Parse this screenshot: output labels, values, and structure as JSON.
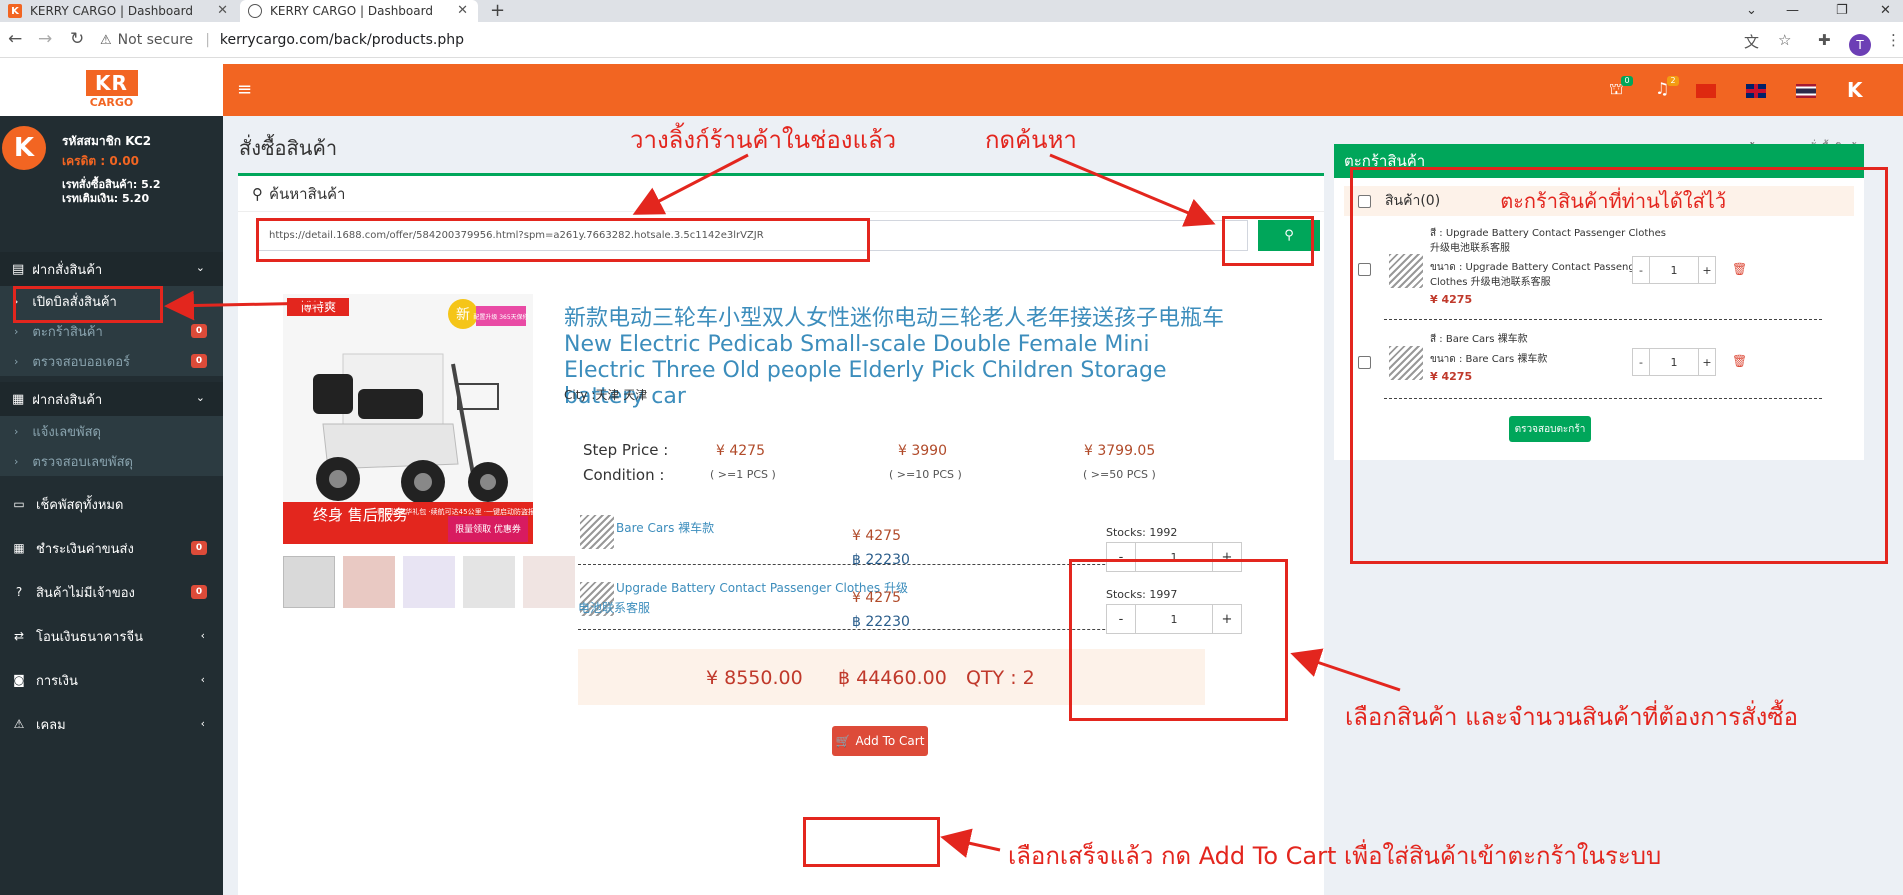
{
  "browser": {
    "tabs": [
      {
        "title": "KERRY CARGO | Dashboard",
        "active": false
      },
      {
        "title": "KERRY CARGO | Dashboard",
        "active": true
      }
    ],
    "new_tab_icon": "plus-icon",
    "not_secure_label": "Not secure",
    "url": "kerrycargo.com/back/products.php",
    "profile_initial": "T"
  },
  "sidebar": {
    "user": {
      "member_code": "รหัสสมาชิก KC2",
      "credit": "เครดิต : 0.00",
      "rate_order": "เรทสั่งซื้อสินค้า: 5.2",
      "rate_topup": "เรทเติมเงิน: 5.20"
    },
    "section_order": "ฝากสั่งสินค้า",
    "order_items": [
      {
        "label": "เปิดบิลสั่งสินค้า",
        "badge": ""
      },
      {
        "label": "ตะกร้าสินค้า",
        "badge": "0"
      },
      {
        "label": "ตรวจสอบออเดอร์",
        "badge": "0"
      }
    ],
    "section_ship": "ฝากส่งสินค้า",
    "ship_items": [
      {
        "label": "แจ้งเลขพัสดุ"
      },
      {
        "label": "ตรวจสอบเลขพัสดุ"
      }
    ],
    "items": [
      {
        "label": "เช็คพัสดุทั้งหมด",
        "badge": ""
      },
      {
        "label": "ชำระเงินค่าขนส่ง",
        "badge": "0"
      },
      {
        "label": "สินค้าไม่มีเจ้าของ",
        "badge": "0"
      },
      {
        "label": "โอนเงินธนาคารจีน",
        "badge": ""
      },
      {
        "label": "การเงิน",
        "badge": ""
      },
      {
        "label": "เคลม",
        "badge": ""
      }
    ]
  },
  "topbar": {
    "cart_badge": "0",
    "bell_badge": "2",
    "logo_letter": "K"
  },
  "logo": {
    "top": "KR",
    "bottom": "CARGO"
  },
  "page": {
    "title": "สั่งซื้อสินค้า",
    "breadcrumb_home": "หน้าแรก",
    "breadcrumb_current": "สั่งซื้อสินค้า"
  },
  "search": {
    "header": "ค้นหาสินค้า",
    "value": "https://detail.1688.com/offer/584200379956.html?spm=a261y.7663282.hotsale.3.5c1142e3lrVZJR"
  },
  "product": {
    "image_banner_brand": "博特爽",
    "image_badge": "新",
    "image_badge_sub": "配置升级 365天保修",
    "image_footer_left": "终身 售后服务",
    "image_footer_mid": "·购车送豪华礼包 ·续航可达45公里 ·一键启动防盗报警",
    "image_footer_right": "限量领取 优惠券",
    "title": "新款电动三轮车小型双人女性迷你电动三轮老人老年接送孩子电瓶车New Electric Pedicab Small-scale Double Female Mini Electric Three Old people Elderly Pick Children Storage battery car",
    "city": "City :天津 天津",
    "step_price_label": "Step Price :",
    "condition_label": "Condition :",
    "steps": [
      {
        "price": "¥ 4275",
        "cond": "( >=1 PCS )"
      },
      {
        "price": "¥ 3990",
        "cond": "( >=10 PCS )"
      },
      {
        "price": "¥ 3799.05",
        "cond": "( >=50 PCS )"
      }
    ],
    "variants": [
      {
        "name": "Bare Cars 裸车款",
        "price_cny": "¥ 4275",
        "price_thb": "฿ 22230",
        "stocks": "Stocks: 1992",
        "qty": "1"
      },
      {
        "name": "Upgrade Battery Contact Passenger Clothes 升级电池联系客服",
        "price_cny": "¥ 4275",
        "price_thb": "฿ 22230",
        "stocks": "Stocks: 1997",
        "qty": "1"
      }
    ],
    "total_cny": "¥ 8550.00",
    "total_thb": "฿ 44460.00",
    "total_qty": "QTY : 2",
    "add_to_cart": "Add To Cart"
  },
  "cart": {
    "header": "ตะกร้าสินค้า",
    "select_all": "สินค้า(0)",
    "items": [
      {
        "color": "สี : Upgrade Battery Contact Passenger Clothes",
        "color_cn": "升级电池联系客服",
        "size": "ขนาด : Upgrade Battery Contact Passenger",
        "size_cn": "Clothes 升级电池联系客服",
        "price": "¥ 4275",
        "qty": "1"
      },
      {
        "color": "สี : Bare Cars 裸车款",
        "size": "ขนาด : Bare Cars 裸车款",
        "price": "¥ 4275",
        "qty": "1"
      }
    ],
    "check_button": "ตรวจสอบตะกร้า"
  },
  "annotations": {
    "paste_link": "วางลิ้งก์ร้านค้าในช่องแล้ว",
    "press_search": "กดค้นหา",
    "cart_note": "ตะกร้าสินค้าที่ท่านได้ใส่ไว้",
    "choose_product": "เลือกสินค้า และจำนวนสินค้าที่ต้องการสั่งซื้อ",
    "finish_add": "เลือกเสร็จแล้ว กด Add To Cart เพื่อใส่สินค้าเข้าตะกร้าในระบบ"
  },
  "colors": {
    "brand_orange": "#f26522",
    "green": "#00a65a",
    "sidebar_bg": "#222d32",
    "annotation_red": "#e3261e",
    "button_red": "#dd4b39",
    "link_blue": "#3c8dbc"
  }
}
